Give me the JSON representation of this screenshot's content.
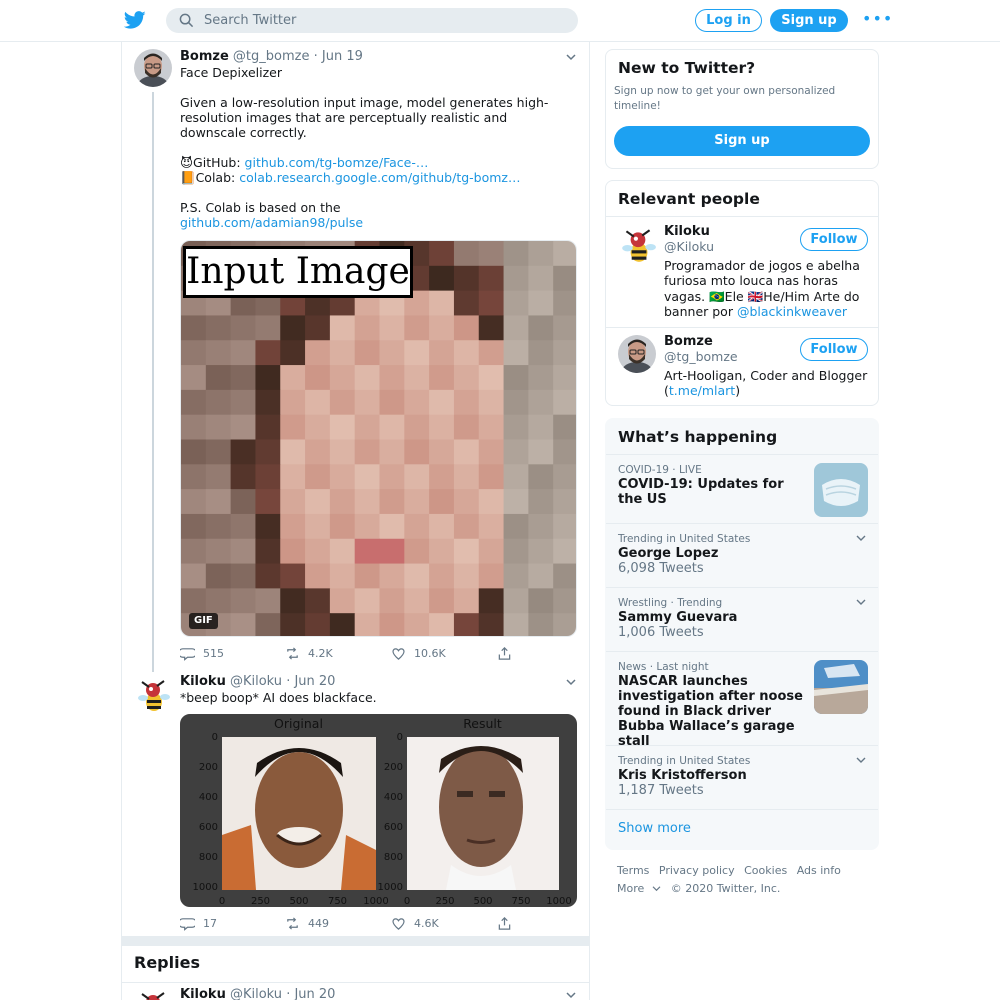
{
  "header": {
    "search_placeholder": "Search Twitter",
    "login_label": "Log in",
    "signup_label": "Sign up",
    "more_label": "•••"
  },
  "tweets": [
    {
      "name": "Bomze",
      "handle": "@tg_bomze",
      "date": "· Jun 19",
      "line1": "Face Depixelizer",
      "line2": "Given a low-resolution input image, model generates high-resolution images that are perceptually realistic and downscale correctly.",
      "github_prefix": "😈GitHub: ",
      "github_link": "github.com/tg-bomze/Face-…",
      "colab_prefix": "📙Colab: ",
      "colab_link": "colab.research.google.com/github/tg-bomz…",
      "ps_text": "P.S. Colab is based on the",
      "ps_link": "github.com/adamian98/pulse",
      "media_label": "Input Image",
      "gif_badge": "GIF",
      "replies": "515",
      "retweets": "4.2K",
      "likes": "10.6K"
    },
    {
      "name": "Kiloku",
      "handle": "@Kiloku",
      "date": "· Jun 20",
      "text": "*beep boop* AI does blackface.",
      "panel_left_title": "Original",
      "panel_right_title": "Result",
      "y_ticks": [
        "0",
        "200",
        "400",
        "600",
        "800",
        "1000"
      ],
      "x_ticks": [
        "0",
        "250",
        "500",
        "750",
        "1000"
      ],
      "replies": "17",
      "retweets": "449",
      "likes": "4.6K"
    }
  ],
  "replies_section": {
    "title": "Replies",
    "first_name": "Kiloku",
    "first_handle": "@Kiloku",
    "first_date": "· Jun 20"
  },
  "sidebar": {
    "new_to_twitter": {
      "title": "New to Twitter?",
      "subtitle": "Sign up now to get your own personalized timeline!",
      "button": "Sign up"
    },
    "relevant_people": {
      "title": "Relevant people",
      "people": [
        {
          "name": "Kiloku",
          "handle": "@Kiloku",
          "follow": "Follow",
          "bio": "Programador de jogos e abelha furiosa mto louca nas horas vagas. 🇧🇷Ele 🇬🇧He/Him Arte do banner por ",
          "bio_link": "@blackinkweaver"
        },
        {
          "name": "Bomze",
          "handle": "@tg_bomze",
          "follow": "Follow",
          "bio": "Art-Hooligan, Coder and Blogger (",
          "bio_link": "t.me/mlart",
          "bio_end": ")"
        }
      ]
    },
    "whats_happening": {
      "title": "What’s happening",
      "trends": [
        {
          "meta": "COVID-19 · LIVE",
          "title": "COVID-19: Updates for the US",
          "count": ""
        },
        {
          "meta": "Trending in United States",
          "title": "George Lopez",
          "count": "6,098 Tweets"
        },
        {
          "meta": "Wrestling · Trending",
          "title": "Sammy Guevara",
          "count": "1,006 Tweets"
        },
        {
          "meta": "News · Last night",
          "title": "NASCAR launches investigation after noose found in Black driver Bubba Wallace’s garage stall",
          "count": ""
        },
        {
          "meta": "Trending in United States",
          "title": "Kris Kristofferson",
          "count": "1,187 Tweets"
        }
      ],
      "show_more": "Show more"
    },
    "footer": {
      "links": [
        "Terms",
        "Privacy policy",
        "Cookies",
        "Ads info"
      ],
      "more": "More",
      "copyright": "© 2020 Twitter, Inc."
    }
  }
}
